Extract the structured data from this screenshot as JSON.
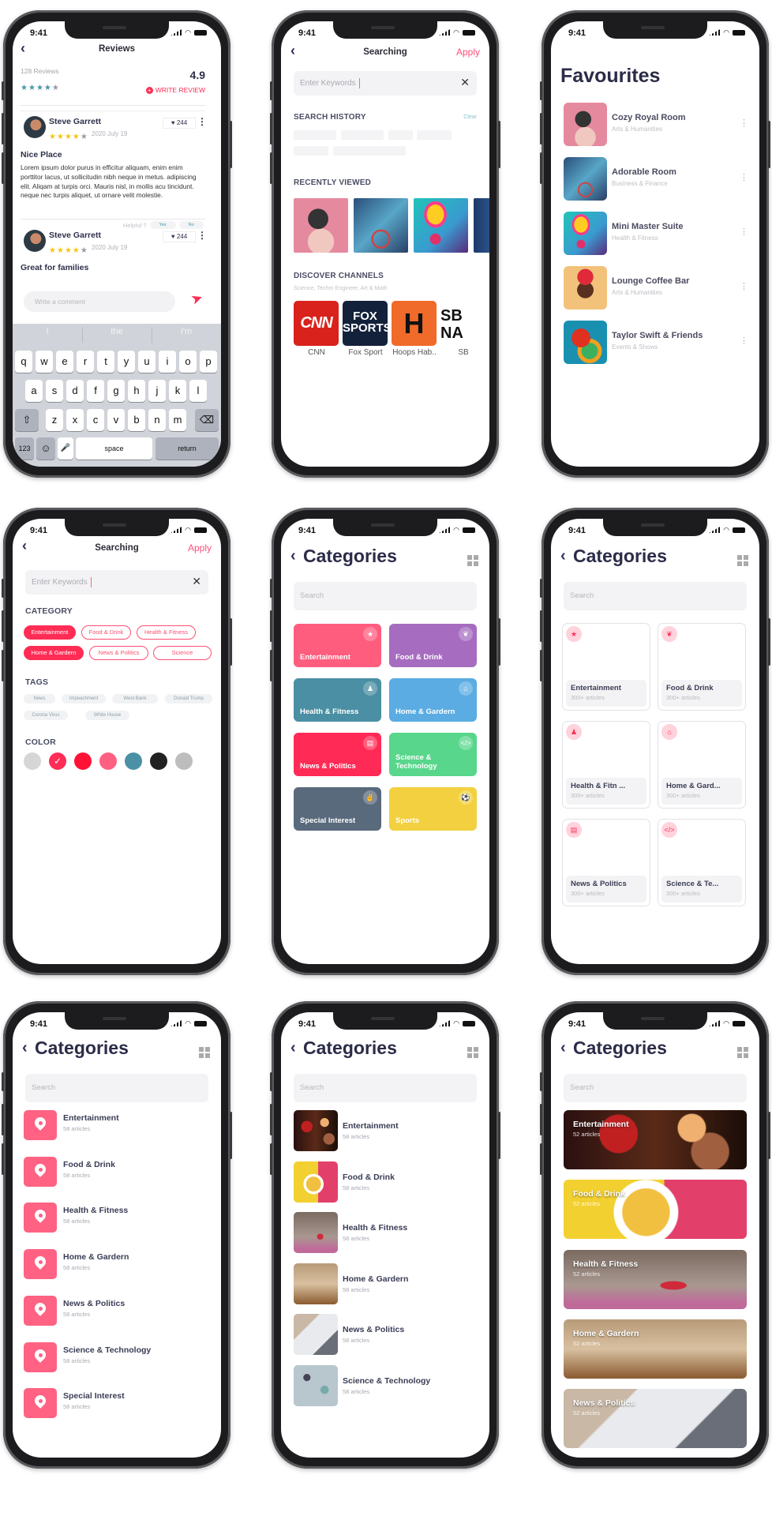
{
  "status": {
    "time": "9:41",
    "icons": [
      "signal-icon",
      "wifi-icon",
      "battery-icon"
    ]
  },
  "colors": {
    "accent": "#ff2d55",
    "accent_soft": "#ff6283",
    "text_dark": "#2d2f4a",
    "star_gold": "#f5c518",
    "star_teal": "#4a97aa"
  },
  "reviews": {
    "title": "Reviews",
    "count_label": "128 Reviews",
    "summary_stars": 4,
    "score": "4.9",
    "write_review": "WRITE REVIEW",
    "items": [
      {
        "name": "Steve Garrett",
        "stars": 4,
        "date": "2020 July 19",
        "likes": "244",
        "title": "Nice Place",
        "body": "Lorem ipsum dolor purus in efficitur aliquam, enim enim porttitor lacus, ut sollicitudin nibh neque in metus. adipiscing elit. Aliqam at turpis orci. Mauris nisl, in mollis acu  tincidunt. neque nec turpis aliquet, ut ornare velit molestie."
      },
      {
        "name": "Steve Garrett",
        "stars": 4,
        "date": "2020 July 19",
        "likes": "244",
        "title": "Great for families"
      }
    ],
    "helpful": {
      "label": "Helpful ?",
      "yes": "Yes",
      "no": "No"
    },
    "comment_placeholder": "Write a comment",
    "keyboard": {
      "suggestions": [
        "I",
        "the",
        "I'm"
      ],
      "row1": [
        "q",
        "w",
        "e",
        "r",
        "t",
        "y",
        "u",
        "i",
        "o",
        "p"
      ],
      "row2": [
        "a",
        "s",
        "d",
        "f",
        "g",
        "h",
        "j",
        "k",
        "l"
      ],
      "row3": [
        "z",
        "x",
        "c",
        "v",
        "b",
        "n",
        "m"
      ],
      "shift": "⇧",
      "delete": "⌫",
      "numbers": "123",
      "emoji": "☺",
      "mic": "🎤",
      "space": "space",
      "return": "return"
    }
  },
  "search": {
    "title": "Searching",
    "apply": "Apply",
    "placeholder": "Enter Keywords",
    "history_title": "SEARCH HISTORY",
    "clear": "Clear",
    "recent_title": "RECENTLY VIEWED",
    "recent_images": [
      "headphones-girl",
      "cyclist-mural",
      "graffiti-face",
      "mural-partial"
    ],
    "channels_title": "DISCOVER CHANNELS",
    "channels_subtitle": "Science, Techm Engineer, Art & Math",
    "channels": [
      {
        "name": "CNN",
        "logo_text": "CNN",
        "color": "#d8221b"
      },
      {
        "name": "Fox Sport",
        "logo_text": "FOX SPORTS",
        "color": "#13213a"
      },
      {
        "name": "Hoops Hab..",
        "logo_text": "H",
        "color": "#f06a2a"
      },
      {
        "name": "SB",
        "logo_text": "SB NA",
        "color": "#ffffff"
      }
    ]
  },
  "favourites": {
    "title": "Favourites",
    "items": [
      {
        "title": "Cozy Royal Room",
        "subtitle": "Arts & Humanities",
        "image": "headphones-girl"
      },
      {
        "title": "Adorable Room",
        "subtitle": "Business & Finance",
        "image": "cyclist-mural"
      },
      {
        "title": "Mini Master Suite",
        "subtitle": "Health & Fitness",
        "image": "graffiti-face"
      },
      {
        "title": "Lounge Coffee Bar",
        "subtitle": "Arts & Humanities",
        "image": "flower-woman"
      },
      {
        "title": "Taylor Swift & Friends",
        "subtitle": "Events & Shows",
        "image": "parrot"
      }
    ]
  },
  "filter": {
    "title": "Searching",
    "apply": "Apply",
    "placeholder": "Enter Keywords",
    "category_title": "CATEGORY",
    "categories": [
      {
        "label": "Entertainment",
        "selected": true
      },
      {
        "label": "Food & Drink",
        "selected": false
      },
      {
        "label": "Health & Fitness",
        "selected": false
      },
      {
        "label": "Home & Gardern",
        "selected": true
      },
      {
        "label": "News & Politics",
        "selected": false
      },
      {
        "label": "Science",
        "selected": false
      }
    ],
    "tags_title": "TAGS",
    "tags": [
      "News",
      "Impeachment",
      "West Bank",
      "Donald Trump",
      "Corona Virus",
      "White House"
    ],
    "color_title": "COLOR",
    "colors": [
      {
        "hex": "#d6d6d6",
        "selected": false
      },
      {
        "hex": "#ff2d55",
        "selected": true
      },
      {
        "hex": "#ff1235",
        "selected": false
      },
      {
        "hex": "#ff5f80",
        "selected": false
      },
      {
        "hex": "#4a91a5",
        "selected": false
      },
      {
        "hex": "#222222",
        "selected": false
      },
      {
        "hex": "#bdbdbd",
        "selected": false
      }
    ]
  },
  "categories_common": {
    "title": "Categories",
    "search_placeholder": "Search"
  },
  "category_tiles": [
    {
      "label": "Entertainment",
      "color": "#ff5d7e",
      "icon": "★"
    },
    {
      "label": "Food & Drink",
      "color": "#a66cc0",
      "icon": "❦"
    },
    {
      "label": "Health & Fitness",
      "color": "#4a8fa3",
      "icon": "♟"
    },
    {
      "label": "Home & Gardern",
      "color": "#5aace2",
      "icon": "⌂"
    },
    {
      "label": "News & Politics",
      "color": "#ff2a55",
      "icon": "▤"
    },
    {
      "label": "Science & Technology",
      "color": "#58d68b",
      "icon": "</>"
    },
    {
      "label": "Special Interest",
      "color": "#5a6a7d",
      "icon": "✌"
    },
    {
      "label": "Sports",
      "color": "#f2d040",
      "icon": "⚽"
    }
  ],
  "category_cards": [
    {
      "label": "Entertainment",
      "count": "300+ articles",
      "icon": "★"
    },
    {
      "label": "Food & Drink",
      "count": "300+ articles",
      "icon": "❦"
    },
    {
      "label": "Health & Fitn ...",
      "count": "300+ articles",
      "icon": "♟"
    },
    {
      "label": "Home & Gard...",
      "count": "300+ articles",
      "icon": "⌂"
    },
    {
      "label": "News & Politics",
      "count": "300+ articles",
      "icon": "▤"
    },
    {
      "label": "Science & Te...",
      "count": "300+ articles",
      "icon": "</>"
    }
  ],
  "category_list": [
    {
      "label": "Entertainment",
      "count": "58 articles"
    },
    {
      "label": "Food & Drink",
      "count": "58 articles"
    },
    {
      "label": "Health & Fitness",
      "count": "58 articles"
    },
    {
      "label": "Home & Gardern",
      "count": "58 articles"
    },
    {
      "label": "News & Politics",
      "count": "58 articles"
    },
    {
      "label": "Science & Technology",
      "count": "58 articles"
    },
    {
      "label": "Special Interest",
      "count": "58 articles"
    }
  ],
  "category_photo_list": [
    {
      "label": "Entertainment",
      "count": "58 articles",
      "image": "microphone"
    },
    {
      "label": "Food & Drink",
      "count": "58 articles",
      "image": "soup-banana"
    },
    {
      "label": "Health & Fitness",
      "count": "58 articles",
      "image": "workout"
    },
    {
      "label": "Home & Gardern",
      "count": "58 articles",
      "image": "dining-room"
    },
    {
      "label": "News & Politics",
      "count": "58 articles",
      "image": "tablet-news"
    },
    {
      "label": "Science & Technology",
      "count": "58 articles",
      "image": "desk-tech"
    }
  ],
  "category_banners": [
    {
      "label": "Entertainment",
      "count": "52 articles",
      "image": "microphone"
    },
    {
      "label": "Food & Drink",
      "count": "52 articles",
      "image": "soup-banana"
    },
    {
      "label": "Health & Fitness",
      "count": "52 articles",
      "image": "workout"
    },
    {
      "label": "Home & Gardern",
      "count": "52 articles",
      "image": "dining-room"
    },
    {
      "label": "News & Politics",
      "count": "52 articles",
      "image": "tablet-news"
    }
  ]
}
